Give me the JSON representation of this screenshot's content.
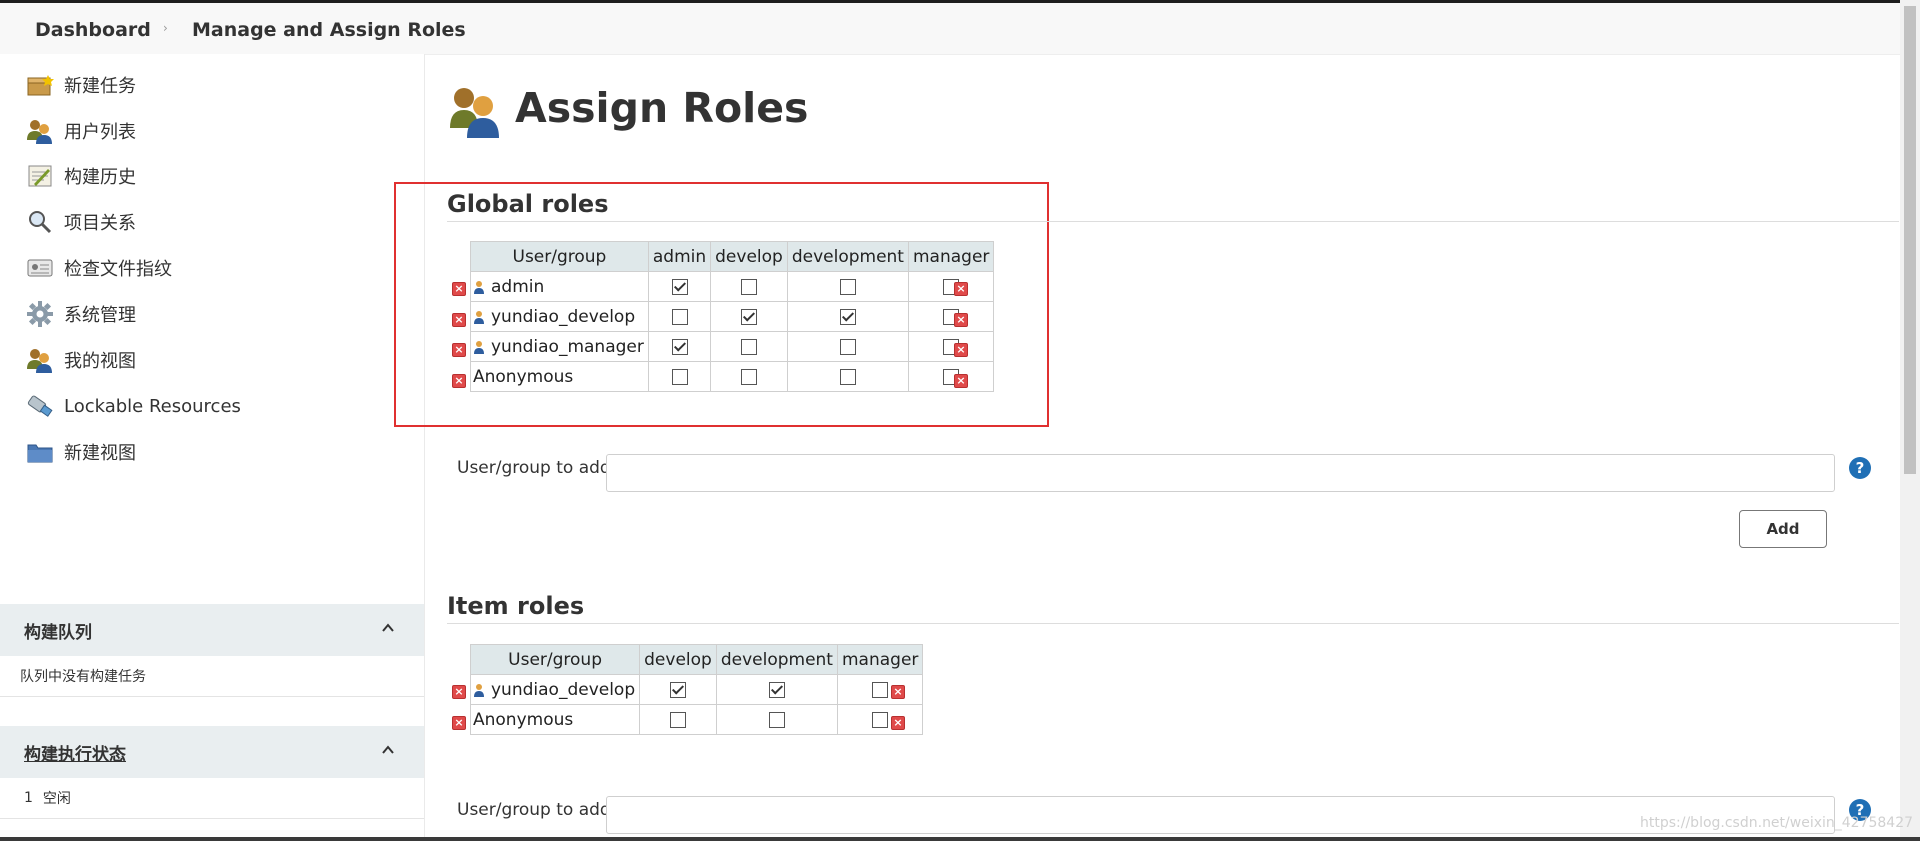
{
  "breadcrumb": {
    "home": "Dashboard",
    "current": "Manage and Assign Roles"
  },
  "sidebar": {
    "tasks": [
      {
        "label": "新建任务",
        "icon": "new-job-icon"
      },
      {
        "label": "用户列表",
        "icon": "users-icon"
      },
      {
        "label": "构建历史",
        "icon": "build-history-icon"
      },
      {
        "label": "项目关系",
        "icon": "search-icon"
      },
      {
        "label": "检查文件指纹",
        "icon": "fingerprint-icon"
      },
      {
        "label": "系统管理",
        "icon": "gear-icon"
      },
      {
        "label": "我的视图",
        "icon": "users-icon"
      },
      {
        "label": "Lockable Resources",
        "icon": "usb-drive-icon"
      },
      {
        "label": "新建视图",
        "icon": "folder-icon"
      }
    ],
    "queue": {
      "title": "构建队列",
      "empty": "队列中没有构建任务"
    },
    "executors": {
      "title": "构建执行状态",
      "status_num": "1",
      "status": "空闲"
    }
  },
  "main": {
    "title": "Assign Roles",
    "global": {
      "heading": "Global roles",
      "header": "User/group",
      "roles": [
        "admin",
        "develop",
        "development",
        "manager"
      ],
      "rows": [
        {
          "name": "admin",
          "user_icon": true,
          "checks": [
            true,
            false,
            false,
            false
          ]
        },
        {
          "name": "yundiao_develop",
          "user_icon": true,
          "checks": [
            false,
            true,
            true,
            false
          ]
        },
        {
          "name": "yundiao_manager",
          "user_icon": true,
          "checks": [
            true,
            false,
            false,
            false
          ]
        },
        {
          "name": "Anonymous",
          "user_icon": false,
          "checks": [
            false,
            false,
            false,
            false
          ]
        }
      ]
    },
    "add_label": "User/group to add",
    "add_value": "",
    "add_button": "Add",
    "help": "?",
    "item": {
      "heading": "Item roles",
      "header": "User/group",
      "roles": [
        "develop",
        "development",
        "manager"
      ],
      "rows": [
        {
          "name": "yundiao_develop",
          "user_icon": true,
          "checks": [
            true,
            true,
            false
          ]
        },
        {
          "name": "Anonymous",
          "user_icon": false,
          "checks": [
            false,
            false,
            false
          ]
        }
      ]
    }
  },
  "watermark": "https://blog.csdn.net/weixin_42758427",
  "colors": {
    "highlight_box": "#e03030",
    "header_bg": "#dfe8ea",
    "help": "#1f6fb5",
    "delete": "#e04a4a"
  }
}
